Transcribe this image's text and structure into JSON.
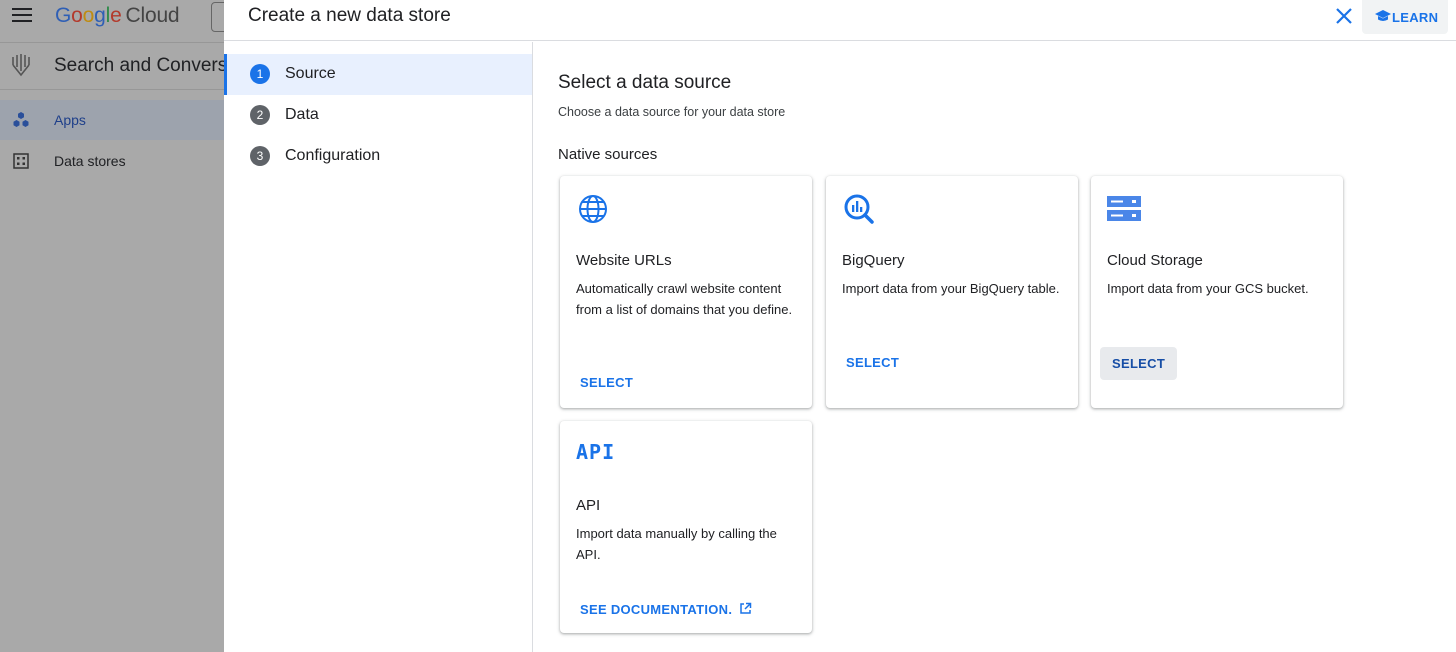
{
  "background": {
    "logo": {
      "google": [
        "G",
        "o",
        "o",
        "g",
        "l",
        "e"
      ],
      "cloud": "Cloud"
    },
    "product_title": "Search and Conversa",
    "nav": [
      {
        "label": "Apps",
        "icon": "apps-hexagon-icon",
        "active": true
      },
      {
        "label": "Data stores",
        "icon": "data-stores-grid-icon",
        "active": false
      }
    ]
  },
  "dialog": {
    "title": "Create a new data store",
    "learn_label": "LEARN",
    "steps": [
      {
        "number": "1",
        "label": "Source",
        "active": true
      },
      {
        "number": "2",
        "label": "Data",
        "active": false
      },
      {
        "number": "3",
        "label": "Configuration",
        "active": false
      }
    ],
    "heading": "Select a data source",
    "subheading": "Choose a data source for your data store",
    "native_title": "Native sources",
    "cards": [
      {
        "icon": "globe-icon",
        "name": "Website URLs",
        "description": "Automatically crawl website content from a list of domains that you define.",
        "action": "SELECT"
      },
      {
        "icon": "bigquery-icon",
        "name": "BigQuery",
        "description": "Import data from your BigQuery table.",
        "action": "SELECT"
      },
      {
        "icon": "cloud-storage-icon",
        "name": "Cloud Storage",
        "description": "Import data from your GCS bucket.",
        "action": "SELECT"
      },
      {
        "icon": "api-icon",
        "icon_text": "API",
        "name": "API",
        "description": "Import data manually by calling the API.",
        "action": "SEE DOCUMENTATION."
      }
    ]
  },
  "colors": {
    "accent": "#1a73e8",
    "overlay": "#a9a9a9",
    "step_active_bg": "#e8f0fe"
  }
}
